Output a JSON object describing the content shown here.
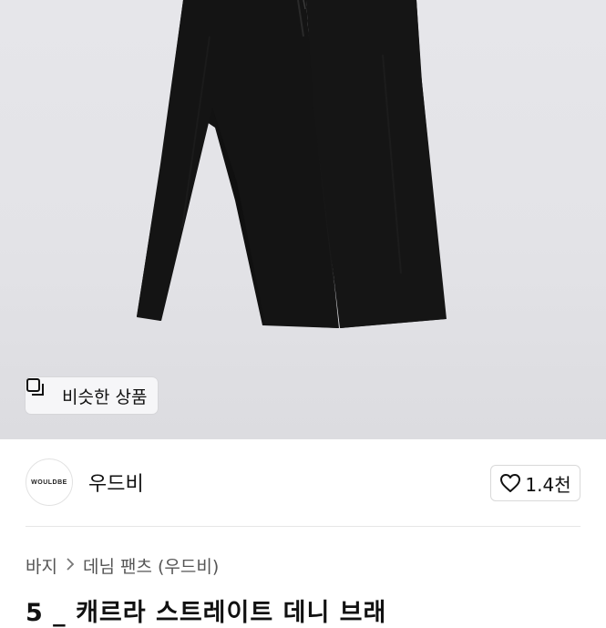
{
  "similar_products": {
    "label": "비슷한 상품",
    "icon": "similar-items-icon"
  },
  "seller": {
    "name": "우드비",
    "logo_text": "WOULDBE"
  },
  "like": {
    "count": "1.4천",
    "icon": "heart-icon"
  },
  "breadcrumb": {
    "items": [
      "바지",
      "데님 팬츠 (우드비)"
    ],
    "separator_icon": "chevron-right-icon"
  },
  "product": {
    "title_partial": "5 _ 캐르라 스트레이트 데니 브래"
  },
  "colors": {
    "image_bg": "#e4e4e8",
    "pants": "#141414",
    "border": "#d9d9d9"
  }
}
